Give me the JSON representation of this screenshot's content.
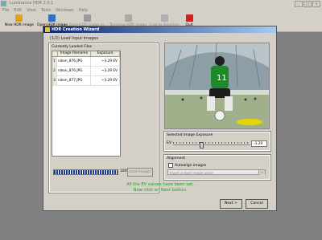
{
  "window": {
    "title": "Luminance HDR 2.0.1"
  },
  "menu": [
    "File",
    "Edit",
    "View",
    "Tools",
    "Windows",
    "Help"
  ],
  "toolbar": [
    {
      "label": "New HDR image",
      "icon": "new-hdr-icon",
      "enabled": true
    },
    {
      "label": "Open HDR image",
      "icon": "open-icon",
      "enabled": true
    },
    {
      "label": "Save HDR image as...",
      "icon": "save-icon",
      "enabled": false
    },
    {
      "label": "Tonemap HDR image",
      "icon": "tonemap-icon",
      "enabled": false
    },
    {
      "label": "Crop to Selection",
      "icon": "crop-icon",
      "enabled": false
    },
    {
      "label": "Quit",
      "icon": "quit-icon",
      "enabled": true
    }
  ],
  "dialog": {
    "title": "HDR Creation Wizard",
    "step": "(1/2) Load Input Images",
    "files_group": "Currently Loaded Files",
    "columns": [
      "",
      "Image Filename",
      "Exposure"
    ],
    "rows": [
      {
        "n": "1",
        "file": "nikon_876.JPG",
        "ev": "~3.29 EV"
      },
      {
        "n": "2",
        "file": "nikon_876.JPG",
        "ev": "~3.29 EV"
      },
      {
        "n": "3",
        "file": "nikon_877.JPG",
        "ev": "~3.29 EV"
      }
    ],
    "progress_pct": "100%",
    "progress_value": 100,
    "load_button": "Load Images",
    "exposure_group": "Selected Image Exposure",
    "ev_label": "EV",
    "ev_value": "-3.29",
    "ev_fraction": 0.36,
    "alignment_group": "Alignment",
    "autoalign_label": "Autoalign images",
    "align_combo": "Insert a start image place",
    "message_line1": "All the EV values have been set.",
    "message_line2": "Now click on Next button.",
    "next_button": "Next >",
    "cancel_button": "Cancel"
  }
}
